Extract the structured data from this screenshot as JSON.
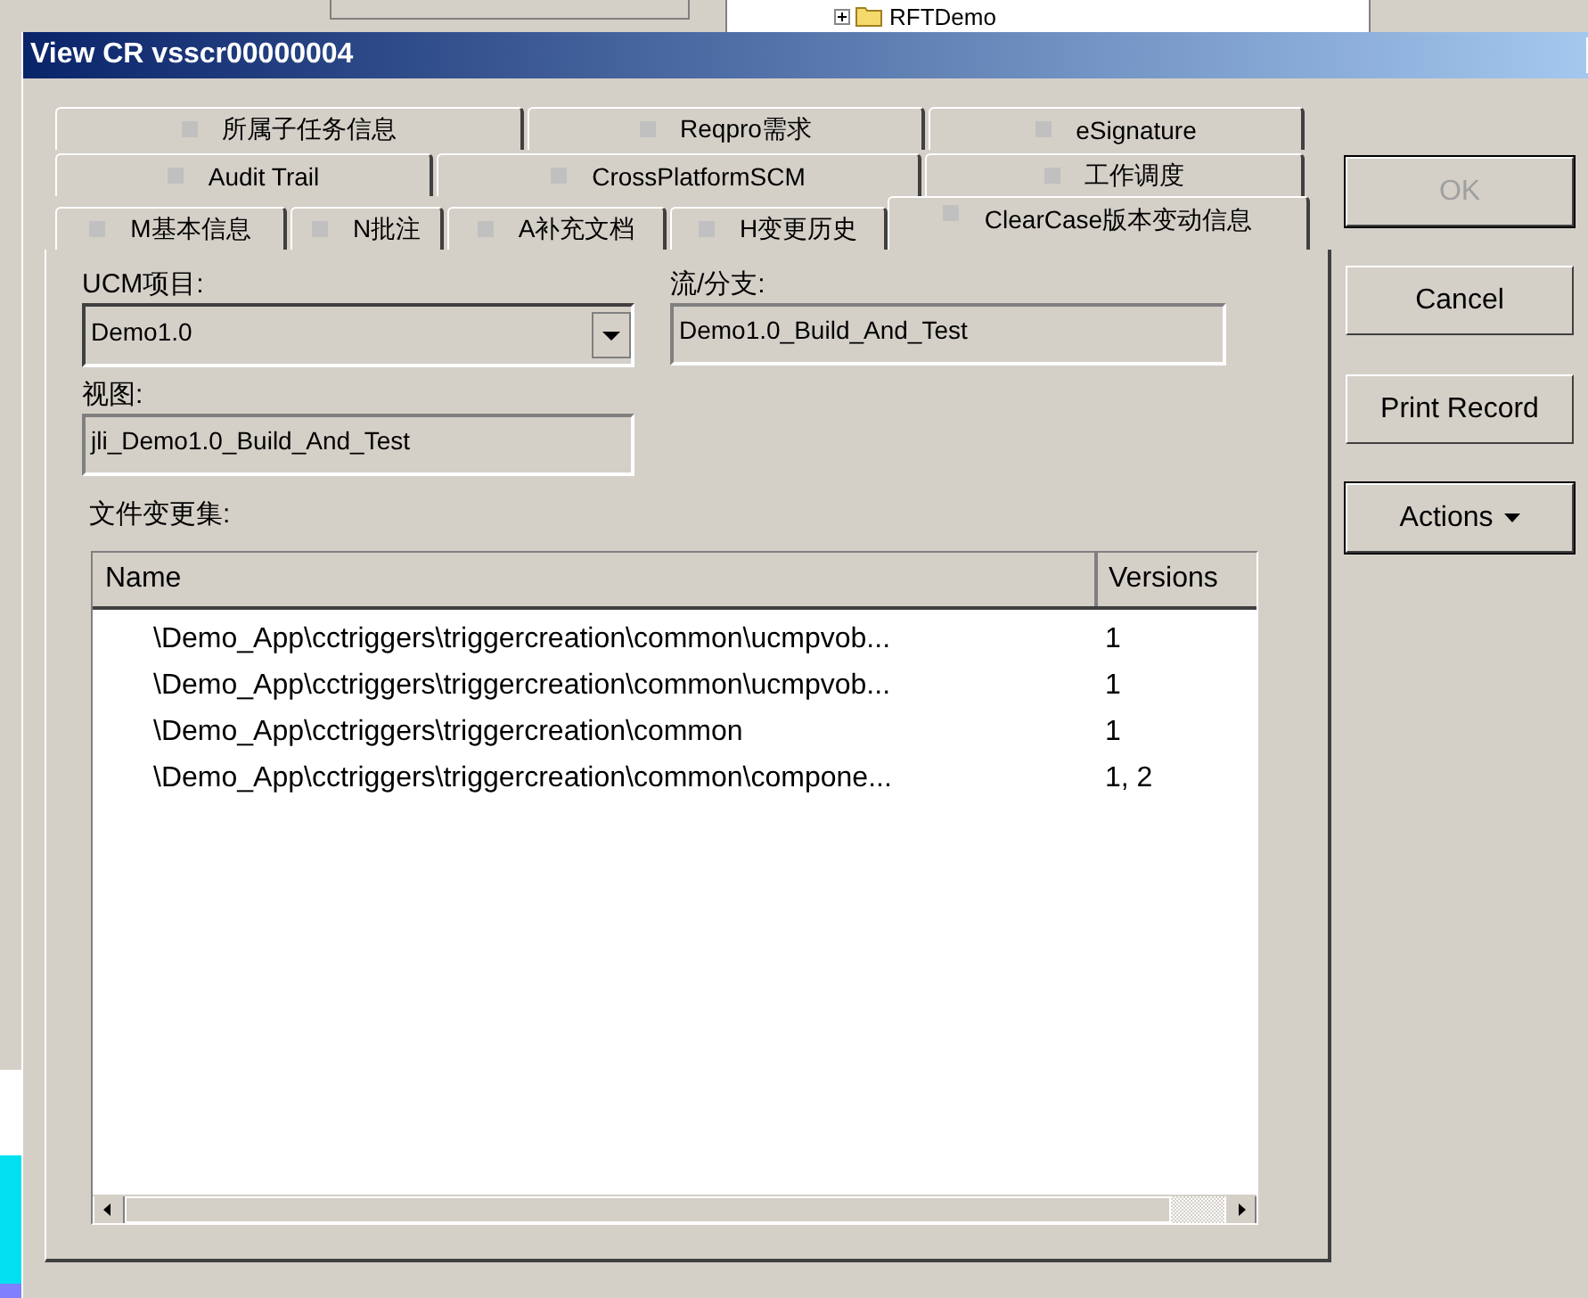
{
  "background": {
    "tree_item": "RFTDemo"
  },
  "window": {
    "title": "View CR vsscr00000004"
  },
  "tab_rows": [
    [
      {
        "label": "所属子任务信息",
        "selected": false
      },
      {
        "label": "Reqpro需求",
        "selected": false
      },
      {
        "label": "eSignature",
        "selected": false
      }
    ],
    [
      {
        "label": "Audit Trail",
        "selected": false
      },
      {
        "label": "CrossPlatformSCM",
        "selected": false
      },
      {
        "label": "工作调度",
        "selected": false
      }
    ],
    [
      {
        "label": "M基本信息",
        "selected": false
      },
      {
        "label": "N批注",
        "selected": false
      },
      {
        "label": "A补充文档",
        "selected": false
      },
      {
        "label": "H变更历史",
        "selected": false
      },
      {
        "label": "ClearCase版本变动信息",
        "selected": true
      }
    ]
  ],
  "ucm_project": {
    "label": "UCM项目:",
    "value": "Demo1.0"
  },
  "stream": {
    "label": "流/分支:",
    "value": "Demo1.0_Build_And_Test"
  },
  "view": {
    "label": "视图:",
    "value": "jli_Demo1.0_Build_And_Test"
  },
  "changeset": {
    "label": "文件变更集:",
    "columns": [
      "Name",
      "Versions"
    ],
    "rows": [
      {
        "name": "\\Demo_App\\cctriggers\\triggercreation\\common\\ucmpvob...",
        "versions": "1"
      },
      {
        "name": "\\Demo_App\\cctriggers\\triggercreation\\common\\ucmpvob...",
        "versions": "1"
      },
      {
        "name": "\\Demo_App\\cctriggers\\triggercreation\\common",
        "versions": "1"
      },
      {
        "name": "\\Demo_App\\cctriggers\\triggercreation\\common\\compone...",
        "versions": "1, 2"
      }
    ]
  },
  "buttons": [
    {
      "label": "OK",
      "disabled": true,
      "kind": "plain"
    },
    {
      "label": "Cancel",
      "disabled": false,
      "kind": "plain"
    },
    {
      "label": "Print Record",
      "disabled": false,
      "kind": "plain"
    },
    {
      "label": "Actions",
      "disabled": false,
      "kind": "menu"
    }
  ]
}
